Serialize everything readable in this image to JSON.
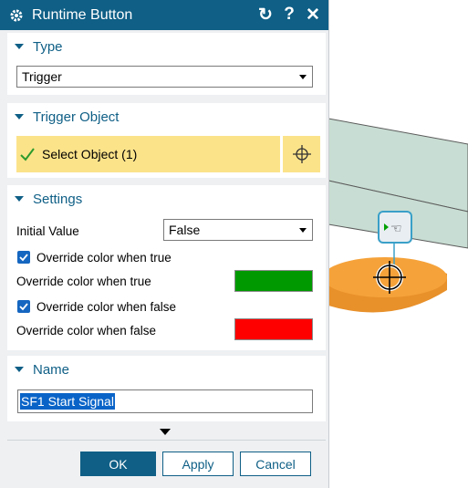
{
  "window": {
    "title": "Runtime Button"
  },
  "title_buttons": {
    "reset": "↻",
    "help": "?",
    "close": "✕"
  },
  "sections": {
    "type": {
      "header": "Type",
      "value": "Trigger"
    },
    "trigger_object": {
      "header": "Trigger Object",
      "select_label": "Select Object (1)"
    },
    "settings": {
      "header": "Settings",
      "initial_value_label": "Initial Value",
      "initial_value": "False",
      "override_true_checkbox_label": "Override color when true",
      "override_true_checked": true,
      "override_true_color_label": "Override color when true",
      "override_true_color": "#009a00",
      "override_false_checkbox_label": "Override color when false",
      "override_false_checked": true,
      "override_false_color_label": "Override color when false",
      "override_false_color": "#ff0000"
    },
    "name": {
      "header": "Name",
      "value": "SF1 Start Signal"
    }
  },
  "buttons": {
    "ok": "OK",
    "apply": "Apply",
    "cancel": "Cancel"
  },
  "colors": {
    "accent": "#0f5f86",
    "selection_yellow": "#fbe38a",
    "model_orange": "#f5a23a",
    "model_green": "#c6ded2"
  }
}
